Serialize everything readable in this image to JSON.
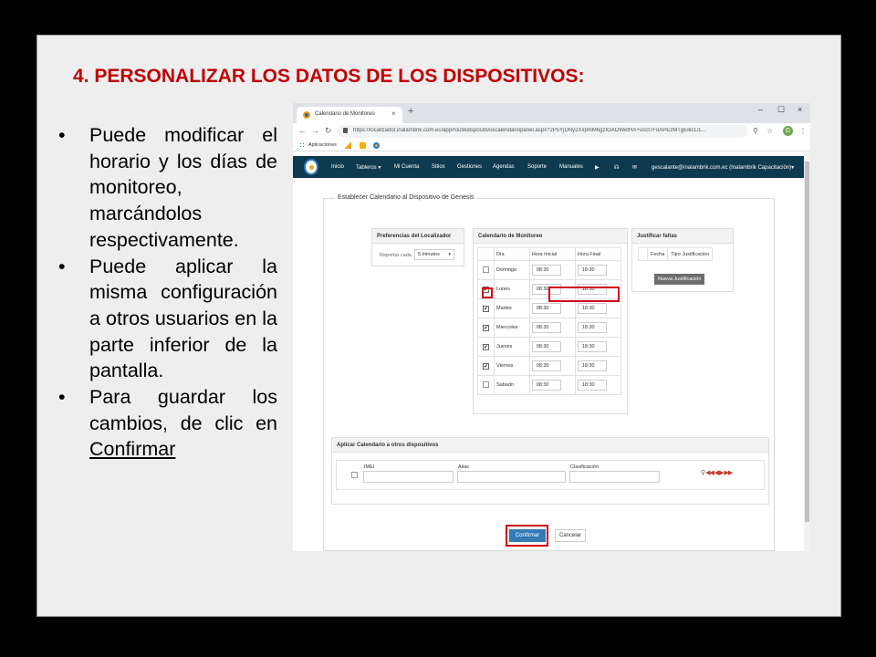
{
  "slide": {
    "title": "4. PERSONALIZAR LOS DATOS DE LOS DISPOSITIVOS:",
    "bullets": [
      {
        "text": "Puede modificar el horario y los días de monitoreo, marcándolos respectivamente."
      },
      {
        "text": "Puede aplicar la misma configuración a otros usuarios en la parte inferior de la pantalla."
      },
      {
        "text_before": "Para guardar los cambios, de clic en ",
        "link": "Confirmar"
      }
    ],
    "bullet_glyph": "•"
  },
  "browser": {
    "tab_title": "Calendario de Monitoreo",
    "tab_close": "×",
    "new_tab": "+",
    "window_controls": [
      "–",
      "☐",
      "×"
    ],
    "url": "https://localizador.inalambrik.com.ec/app/routikdispositivoscalendariopanel.aspx?2P5YjDNy2XxpmM6gzIGAOWetHA+uscf7FoAPEzMTgEikcL/L...",
    "bookmarks_label": "Aplicaciones",
    "profile_initial": "G"
  },
  "app": {
    "nav": [
      "Inicio",
      "Tableros ▾",
      "Mi Cuenta",
      "Sitios",
      "Gestiones",
      "Agendas",
      "Soporte",
      "Manuales"
    ],
    "user": "gescalante@inalambrik.com.ec (Inalambrik Capacitación)▾",
    "section_title": "Establecer Calendario al Dispositivo de Genesis",
    "prefs": {
      "title": "Preferencias del Localizador",
      "report_label": "Reportar cada",
      "report_value": "5 minutos"
    },
    "calendar": {
      "title": "Calendario de Monitoreo",
      "headers": [
        "Día",
        "Hora Inicial",
        "Hora Final"
      ],
      "rows": [
        {
          "day": "Domingo",
          "checked": "",
          "start": "08:30",
          "end": "18:30"
        },
        {
          "day": "Lunes",
          "checked": "✔",
          "start": "08:30",
          "end": "18:30"
        },
        {
          "day": "Martes",
          "checked": "✔",
          "start": "08:30",
          "end": "18:30"
        },
        {
          "day": "Miercoles",
          "checked": "✔",
          "start": "08:30",
          "end": "18:30"
        },
        {
          "day": "Jueves",
          "checked": "✔",
          "start": "08:30",
          "end": "18:30"
        },
        {
          "day": "Viernes",
          "checked": "✔",
          "start": "08:30",
          "end": "18:30"
        },
        {
          "day": "Sabado",
          "checked": "",
          "start": "08:30",
          "end": "18:30"
        }
      ]
    },
    "justify": {
      "title": "Justificar faltas",
      "col_date": "Fecha",
      "col_type": "Tipo Justificación",
      "new_button": "Nueva Justificación"
    },
    "apply": {
      "title": "Aplicar Calendario a otros dispositivos",
      "imei": "IMEI",
      "alias": "Alias",
      "classification": "Clasificación",
      "pager": "◀◀ ◀ ▶ ▶▶"
    },
    "confirm_label": "Confirmar",
    "cancel_label": "Cancelar"
  },
  "colors": {
    "title_red": "#c00000",
    "nav_bg": "#0e3a4f",
    "highlight": "#d0021b",
    "primary": "#337ab7"
  }
}
